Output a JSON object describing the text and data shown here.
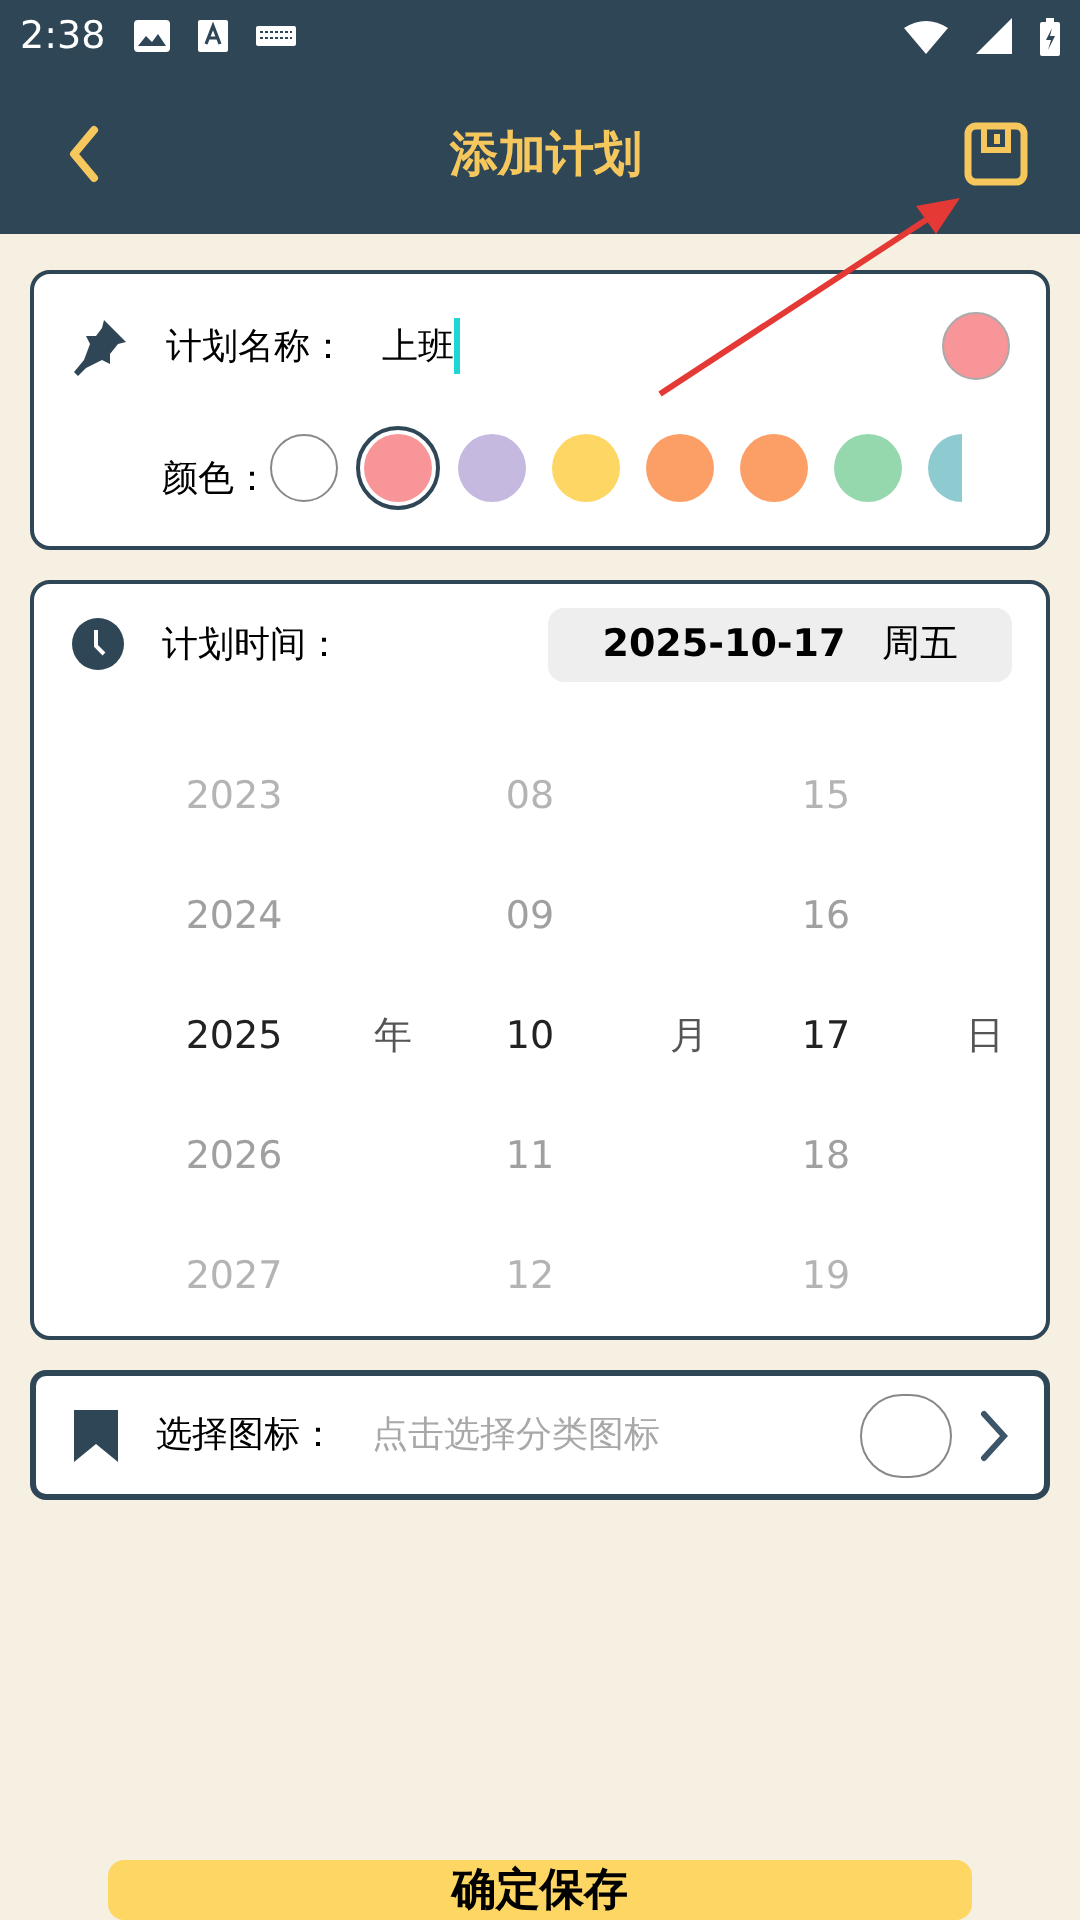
{
  "status_bar": {
    "time": "2:38"
  },
  "header": {
    "title": "添加计划"
  },
  "name_card": {
    "label": "计划名称：",
    "value": "上班",
    "color_label": "颜色：",
    "colors": [
      {
        "color": "#ffffff",
        "selected": false
      },
      {
        "color": "#f89598",
        "selected": true
      },
      {
        "color": "#c6b9e0",
        "selected": false
      },
      {
        "color": "#fdd663",
        "selected": false
      },
      {
        "color": "#fb9f66",
        "selected": false
      },
      {
        "color": "#fb9f66",
        "selected": false
      },
      {
        "color": "#95d8ae",
        "selected": false
      },
      {
        "color": "#8dcbd0",
        "selected": false
      }
    ]
  },
  "time_card": {
    "label": "计划时间：",
    "date": "2025-10-17",
    "weekday": "周五",
    "columns": [
      {
        "unit": "年",
        "items": [
          {
            "text": "2023",
            "selected": false
          },
          {
            "text": "2024",
            "selected": false
          },
          {
            "text": "2025",
            "selected": true
          },
          {
            "text": "2026",
            "selected": false
          },
          {
            "text": "2027",
            "selected": false
          }
        ]
      },
      {
        "unit": "月",
        "items": [
          {
            "text": "08",
            "selected": false
          },
          {
            "text": "09",
            "selected": false
          },
          {
            "text": "10",
            "selected": true
          },
          {
            "text": "11",
            "selected": false
          },
          {
            "text": "12",
            "selected": false
          }
        ]
      },
      {
        "unit": "日",
        "items": [
          {
            "text": "15",
            "selected": false
          },
          {
            "text": "16",
            "selected": false
          },
          {
            "text": "17",
            "selected": true
          },
          {
            "text": "18",
            "selected": false
          },
          {
            "text": "19",
            "selected": false
          }
        ]
      }
    ]
  },
  "icon_card": {
    "label": "选择图标：",
    "placeholder": "点击选择分类图标"
  },
  "confirm_button": "确定保存"
}
